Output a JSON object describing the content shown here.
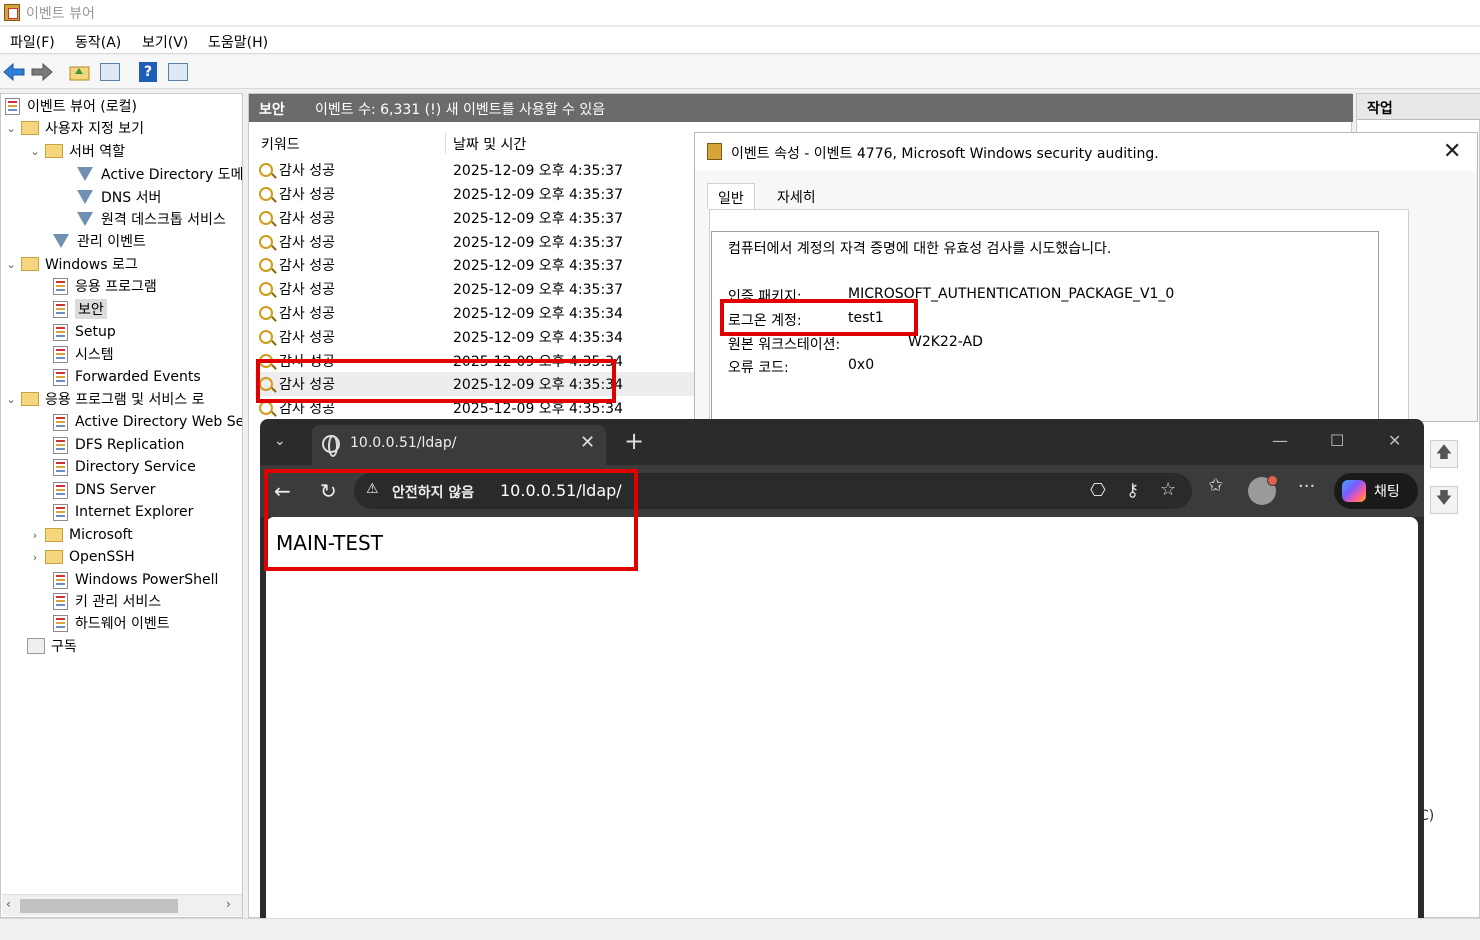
{
  "window": {
    "title": "이벤트 뷰어"
  },
  "menu": [
    "파일(F)",
    "동작(A)",
    "보기(V)",
    "도움말(H)"
  ],
  "tree": {
    "root": "이벤트 뷰어 (로컬)",
    "custom_views": "사용자 지정 보기",
    "server_roles": "서버 역할",
    "ad_domain": "Active Directory 도메",
    "dns_server": "DNS 서버",
    "remote_desktop": "원격 데스크톱 서비스",
    "admin_events": "관리 이벤트",
    "windows_logs": "Windows 로그",
    "application": "응용 프로그램",
    "security": "보안",
    "setup": "Setup",
    "system": "시스템",
    "forwarded": "Forwarded Events",
    "apps_services": "응용 프로그램 및 서비스 로",
    "ad_web": "Active Directory Web Ser",
    "dfs": "DFS Replication",
    "dir_service": "Directory Service",
    "dns_server2": "DNS Server",
    "ie": "Internet Explorer",
    "microsoft": "Microsoft",
    "openssh": "OpenSSH",
    "powershell": "Windows PowerShell",
    "key_mgmt": "키 관리 서비스",
    "hardware": "하드웨어 이벤트",
    "subscriptions": "구독"
  },
  "center": {
    "log_name": "보안",
    "count_text": "이벤트 수: 6,331 (!) 새 이벤트를 사용할 수 있음",
    "col_keyword": "키워드",
    "col_datetime": "날짜 및 시간",
    "events": [
      {
        "keyword": "감사 성공",
        "datetime": "2025-12-09 오후 4:35:37"
      },
      {
        "keyword": "감사 성공",
        "datetime": "2025-12-09 오후 4:35:37"
      },
      {
        "keyword": "감사 성공",
        "datetime": "2025-12-09 오후 4:35:37"
      },
      {
        "keyword": "감사 성공",
        "datetime": "2025-12-09 오후 4:35:37"
      },
      {
        "keyword": "감사 성공",
        "datetime": "2025-12-09 오후 4:35:37"
      },
      {
        "keyword": "감사 성공",
        "datetime": "2025-12-09 오후 4:35:37"
      },
      {
        "keyword": "감사 성공",
        "datetime": "2025-12-09 오후 4:35:34"
      },
      {
        "keyword": "감사 성공",
        "datetime": "2025-12-09 오후 4:35:34"
      },
      {
        "keyword": "감사 성공",
        "datetime": "2025-12-09 오후 4:35:34"
      },
      {
        "keyword": "감사 성공",
        "datetime": "2025-12-09 오후 4:35:34"
      },
      {
        "keyword": "감사 성공",
        "datetime": "2025-12-09 오후 4:35:34"
      }
    ]
  },
  "actions": {
    "header": "작업",
    "partial": "C)"
  },
  "dialog": {
    "title": "이벤트 속성 - 이벤트 4776, Microsoft Windows security auditing.",
    "tab_general": "일반",
    "tab_details": "자세히",
    "description": "컴퓨터에서 계정의 자격 증명에 대한 유효성 검사를 시도했습니다.",
    "auth_pkg_label": "인증 패키지:",
    "auth_pkg_value": "MICROSOFT_AUTHENTICATION_PACKAGE_V1_0",
    "logon_account_label": "로그온 계정:",
    "logon_account_value": "test1",
    "source_ws_label": "원본 워크스테이션:",
    "source_ws_value": "W2K22-AD",
    "error_code_label": "오류 코드:",
    "error_code_value": "0x0"
  },
  "browser": {
    "tab_title": "10.0.0.51/ldap/",
    "not_secure": "안전하지 않음",
    "url": "10.0.0.51/ldap/",
    "chat_label": "채팅",
    "page_text": "MAIN-TEST"
  },
  "colors": {
    "annotation": "#e00000",
    "browser_chrome": "#2b2b2b"
  }
}
